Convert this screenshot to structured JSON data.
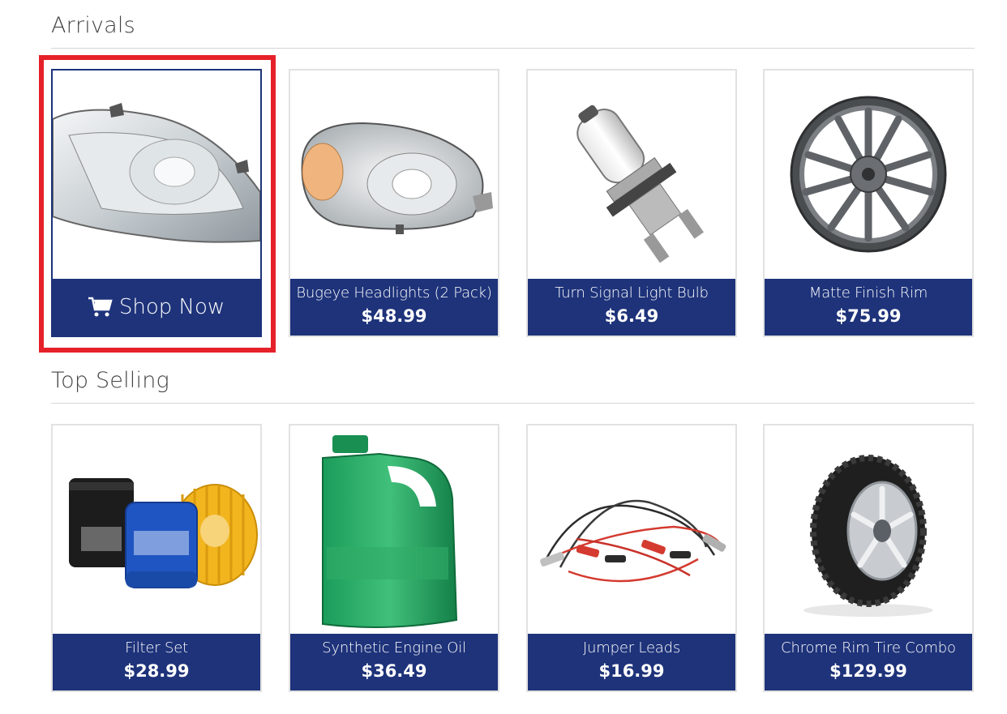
{
  "sections": [
    {
      "title": "Arrivals",
      "products": [
        {
          "name": "",
          "price": "",
          "action_label": "Shop Now",
          "image": "headlight-icon"
        },
        {
          "name": "Bugeye Headlights (2 Pack)",
          "price": "$48.99",
          "image": "bugeye-headlight-icon"
        },
        {
          "name": "Turn Signal Light Bulb",
          "price": "$6.49",
          "image": "light-bulb-icon"
        },
        {
          "name": "Matte Finish Rim",
          "price": "$75.99",
          "image": "rim-icon"
        }
      ]
    },
    {
      "title": "Top Selling",
      "products": [
        {
          "name": "Filter Set",
          "price": "$28.99",
          "image": "oil-filter-icon"
        },
        {
          "name": "Synthetic Engine Oil",
          "price": "$36.49",
          "image": "oil-jug-icon"
        },
        {
          "name": "Jumper Leads",
          "price": "$16.99",
          "image": "jumper-cables-icon"
        },
        {
          "name": "Chrome Rim Tire Combo",
          "price": "$129.99",
          "image": "tire-icon"
        }
      ]
    }
  ],
  "colors": {
    "accent": "#1e337a",
    "highlight": "#e52129",
    "border": "#e2e2e2"
  }
}
